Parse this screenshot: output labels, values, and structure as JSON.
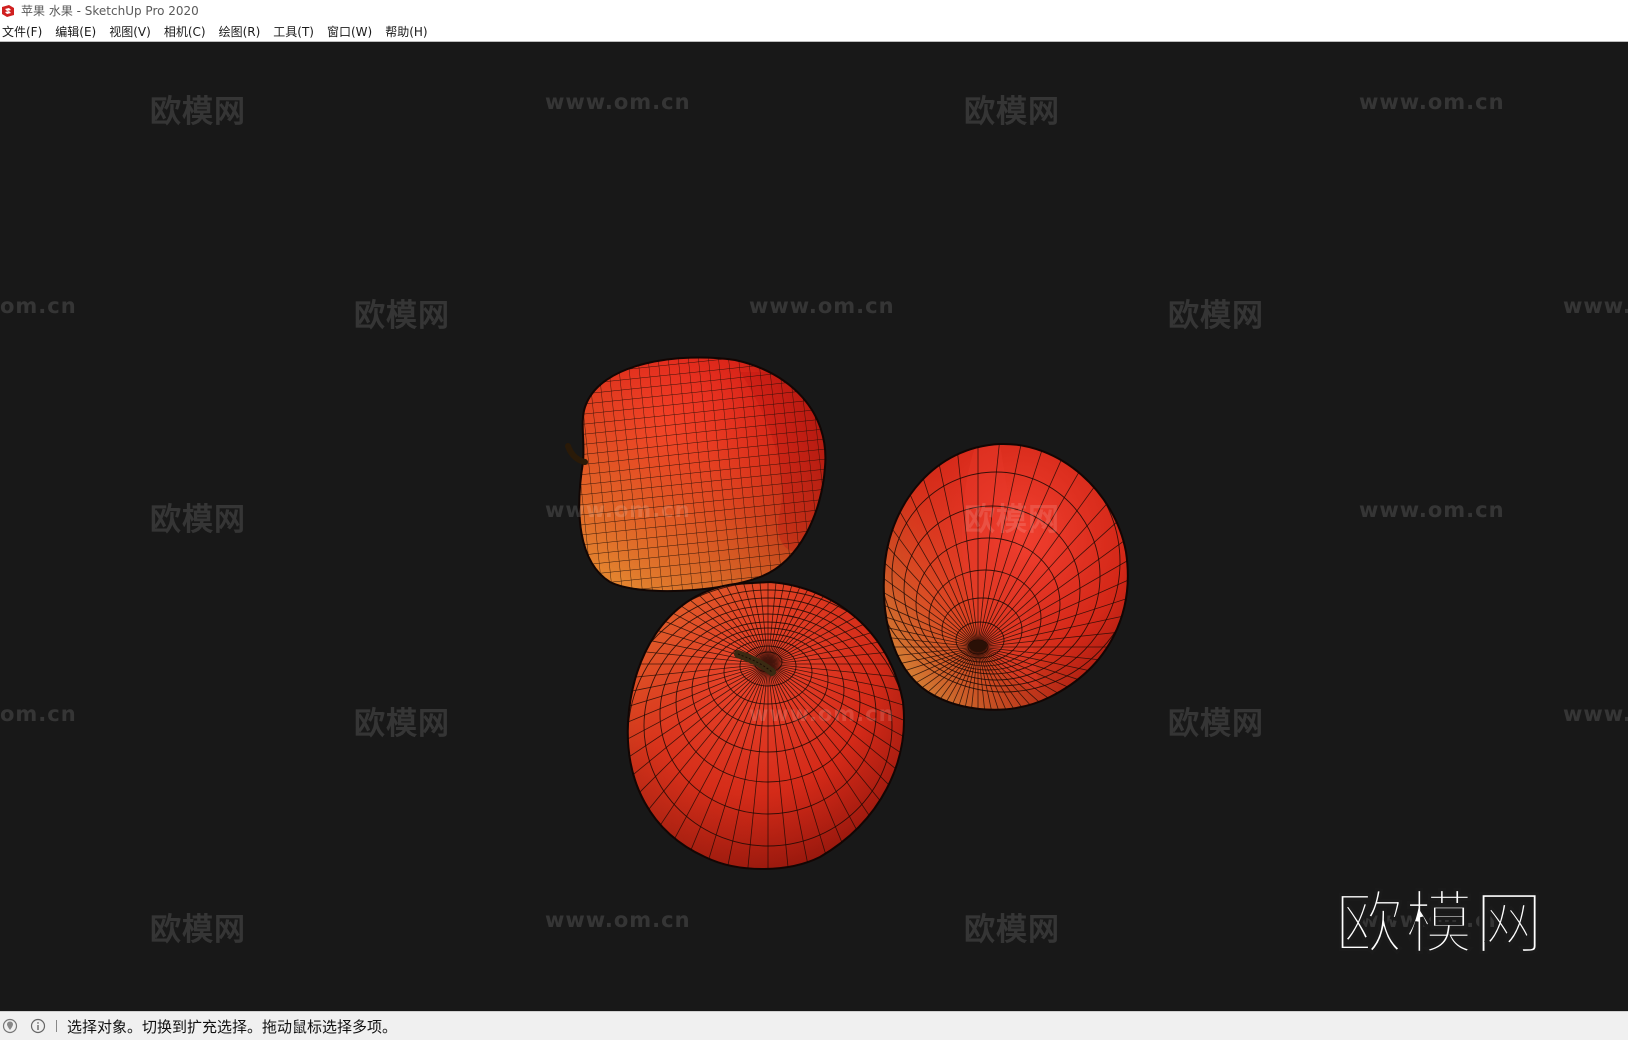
{
  "window": {
    "title": "苹果 水果 - SketchUp Pro 2020"
  },
  "menu": [
    {
      "label": "文件(F)"
    },
    {
      "label": "编辑(E)"
    },
    {
      "label": "视图(V)"
    },
    {
      "label": "相机(C)"
    },
    {
      "label": "绘图(R)"
    },
    {
      "label": "工具(T)"
    },
    {
      "label": "窗口(W)"
    },
    {
      "label": "帮助(H)"
    }
  ],
  "watermark": {
    "brand": "欧模网",
    "url_full": "www.om.cn",
    "url_left_cut": "om.cn",
    "url_right_cut": "www.",
    "url_right_cut_long": "www.o"
  },
  "status": {
    "text": "选择对象。切换到扩充选择。拖动鼠标选择多项。",
    "icons": [
      "geo-location-icon",
      "info-icon"
    ]
  },
  "colors": {
    "viewport_bg": "#181818",
    "apple_red": "#d42418",
    "apple_yellow": "#e8a040",
    "wire": "#1a0a05"
  }
}
